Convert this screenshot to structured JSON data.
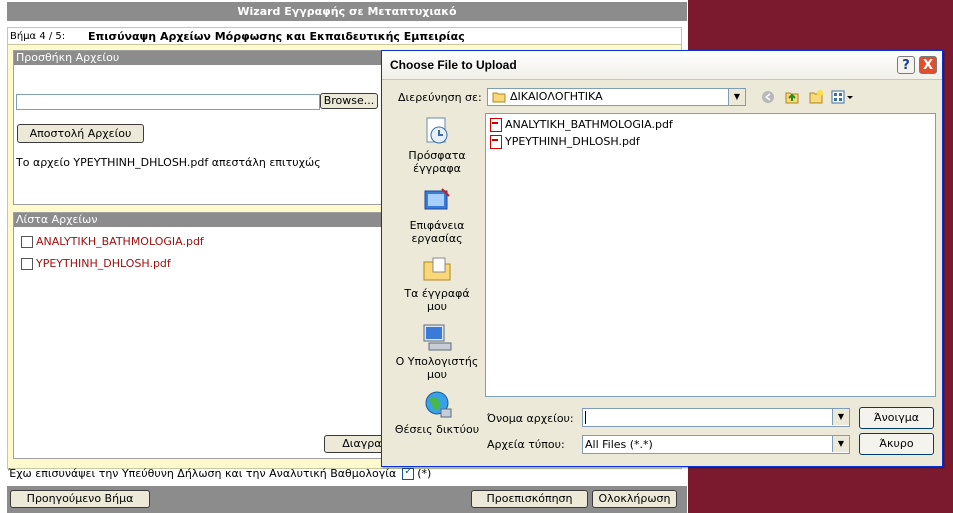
{
  "wizard": {
    "title": "Wizard Εγγραφής σε Μεταπτυχιακό",
    "step_label": "Βήμα 4 / 5:",
    "step_title": "Επισύναψη Αρχείων Μόρφωσης και Εκπαιδευτικής Εμπειρίας",
    "upload_section_title": "Προσθήκη Αρχείου",
    "browse_label": "Browse...",
    "send_label": "Αποστολή Αρχείου",
    "upload_message": "Το αρχείο YPEYTHINH_DHLOSH.pdf απεστάλη επιτυχώς",
    "list_section_title": "Λίστα Αρχείων",
    "files": [
      "ANALYTIKH_BATHMOLOGIA.pdf",
      "YPEYTHINH_DHLOSH.pdf"
    ],
    "delete_label": "Διαγραφή",
    "confirm_text": "Έχω επισυνάψει την Υπεύθυνη Δήλωση και την Αναλυτική Βαθμολογία",
    "confirm_mark": "(*)",
    "prev_label": "Προηγούμενο Βήμα",
    "preview_label": "Προεπισκόπηση",
    "finish_label": "Ολοκλήρωση"
  },
  "dialog": {
    "title": "Choose File to Upload",
    "look_in_label": "Διερεύνηση σε:",
    "look_in_value": "ΔΙΚΑΙΟΛΟΓΗΤΙΚΑ",
    "places": [
      {
        "label": "Πρόσφατα έγγραφα",
        "icon": "recent-documents-icon"
      },
      {
        "label": "Επιφάνεια εργασίας",
        "icon": "desktop-icon"
      },
      {
        "label": "Τα έγγραφά μου",
        "icon": "my-documents-icon"
      },
      {
        "label": "Ο Υπολογιστής μου",
        "icon": "my-computer-icon"
      },
      {
        "label": "Θέσεις δικτύου",
        "icon": "network-places-icon"
      }
    ],
    "files": [
      "ANALYTIKH_BATHMOLOGIA.pdf",
      "YPEYTHINH_DHLOSH.pdf"
    ],
    "filename_label": "Όνομα αρχείου:",
    "filename_value": "",
    "filetype_label": "Αρχεία τύπου:",
    "filetype_value": "All Files (*.*)",
    "open_label": "Άνοιγμα",
    "cancel_label": "Άκυρο",
    "help_label": "?",
    "close_label": "X"
  },
  "colors": {
    "maroon_background": "#7b1a2e",
    "header_gray": "#8c8c8c",
    "panel_yellow": "#fffacd",
    "file_link": "#a01010",
    "close_red": "#e0502e"
  }
}
